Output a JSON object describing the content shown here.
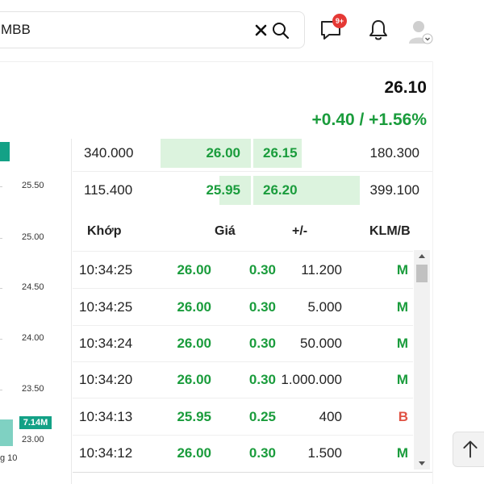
{
  "header": {
    "search_value": "MBB",
    "notification_badge": "9+"
  },
  "quote": {
    "price": "26.10",
    "change": "+0.40 / +1.56%"
  },
  "chart": {
    "y_ticks": [
      "25.50",
      "25.00",
      "24.50",
      "24.00",
      "23.50",
      "23.00"
    ],
    "volume_label": "7.14M",
    "x_label_partial": "g 10"
  },
  "order_book": [
    {
      "bid_qty": "340.000",
      "bid_price": "26.00",
      "ask_price": "26.15",
      "ask_qty": "180.300",
      "bid_fill": 0.6,
      "ask_fill": 0.45
    },
    {
      "bid_qty": "115.400",
      "bid_price": "25.95",
      "ask_price": "26.20",
      "ask_qty": "399.100",
      "bid_fill": 0.2,
      "ask_fill": 1.0
    }
  ],
  "trades": {
    "headers": {
      "time": "Khớp",
      "price": "Giá",
      "change": "+/-",
      "volume": "KLM/B"
    },
    "rows": [
      {
        "time": "10:34:25",
        "price": "26.00",
        "change": "0.30",
        "volume": "11.200",
        "side": "M"
      },
      {
        "time": "10:34:25",
        "price": "26.00",
        "change": "0.30",
        "volume": "5.000",
        "side": "M"
      },
      {
        "time": "10:34:24",
        "price": "26.00",
        "change": "0.30",
        "volume": "50.000",
        "side": "M"
      },
      {
        "time": "10:34:20",
        "price": "26.00",
        "change": "0.30",
        "volume": "1.000.000",
        "side": "M"
      },
      {
        "time": "10:34:13",
        "price": "25.95",
        "change": "0.25",
        "volume": "400",
        "side": "B"
      },
      {
        "time": "10:34:12",
        "price": "26.00",
        "change": "0.30",
        "volume": "1.500",
        "side": "M"
      }
    ]
  },
  "colors": {
    "up": "#1a9c3c",
    "sell": "#e05243",
    "bar_fill": "#dcf3de",
    "teal": "#13a186"
  },
  "icons": {
    "clear": "close-icon",
    "search": "search-icon",
    "chat": "chat-icon",
    "bell": "bell-icon",
    "avatar": "user-avatar-icon",
    "to_top": "arrow-up-icon"
  }
}
